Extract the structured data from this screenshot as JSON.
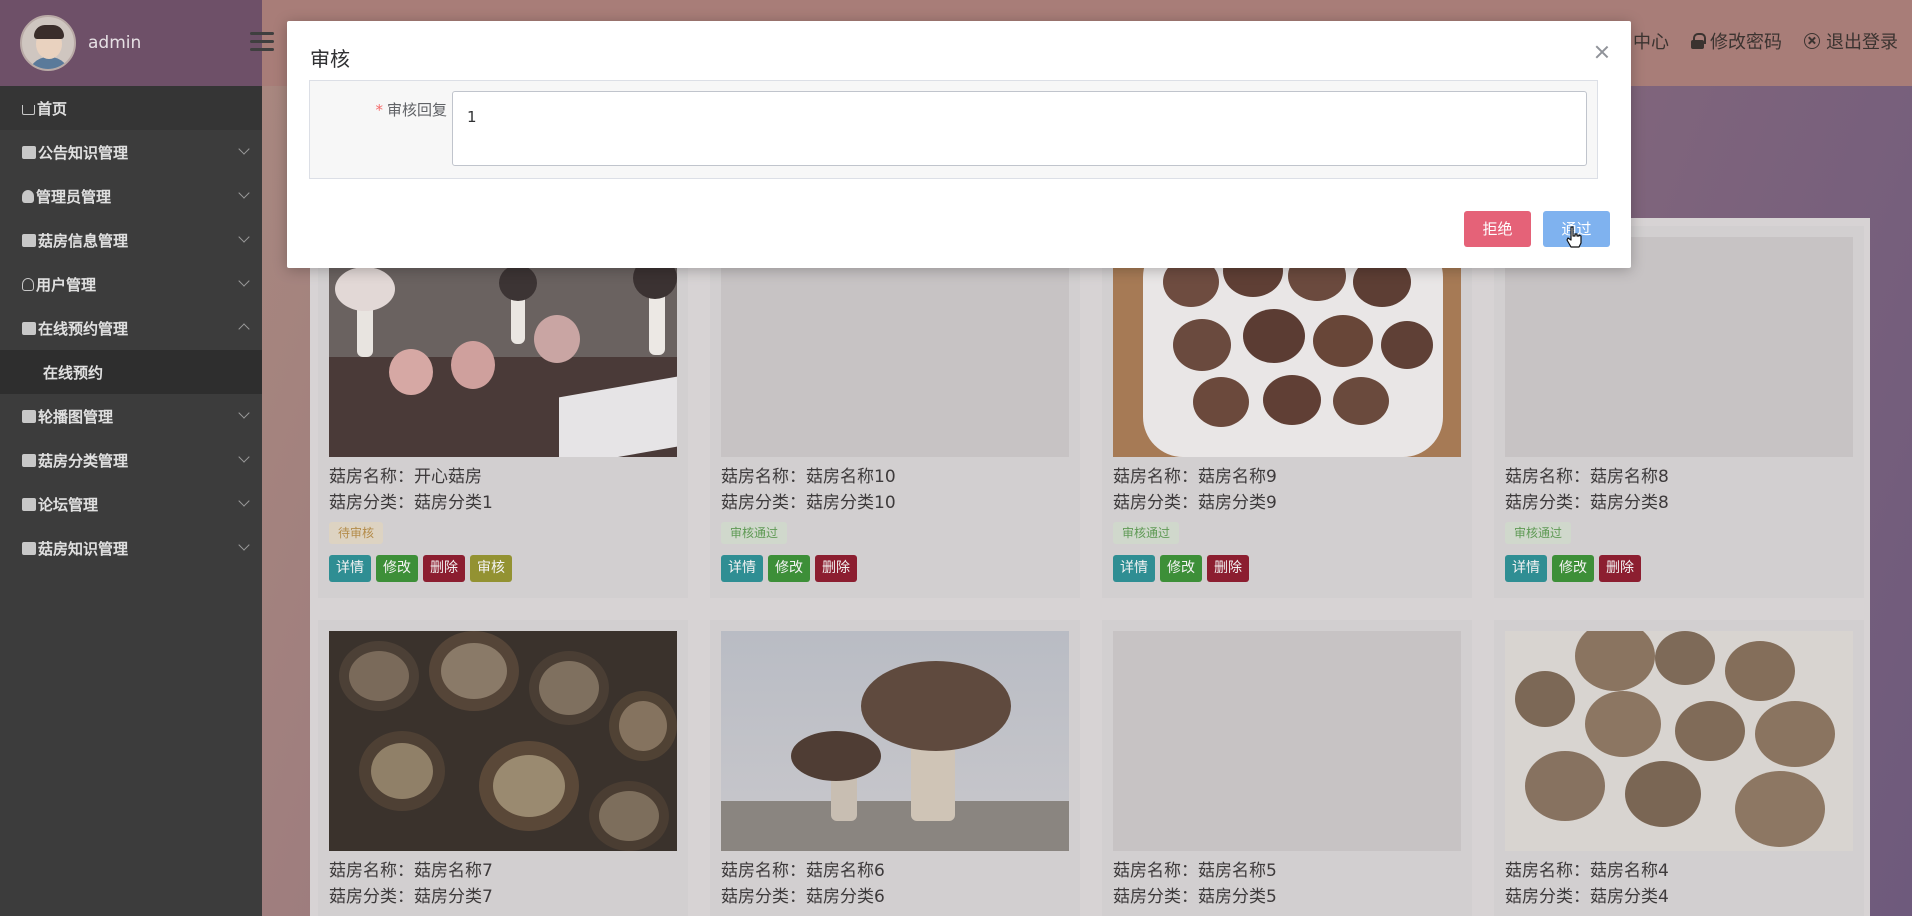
{
  "sidebar": {
    "username": "admin",
    "items": [
      {
        "label": "首页",
        "icon": "home-icon"
      },
      {
        "label": "公告知识管理",
        "icon": "briefcase-icon"
      },
      {
        "label": "管理员管理",
        "icon": "user-icon"
      },
      {
        "label": "菇房信息管理",
        "icon": "printer-icon"
      },
      {
        "label": "用户管理",
        "icon": "user-outline-icon"
      },
      {
        "label": "在线预约管理",
        "icon": "folder-icon",
        "expanded": true,
        "children": [
          "在线预约"
        ]
      },
      {
        "label": "轮播图管理",
        "icon": "list-icon"
      },
      {
        "label": "菇房分类管理",
        "icon": "list-icon"
      },
      {
        "label": "论坛管理",
        "icon": "bank-icon"
      },
      {
        "label": "菇房知识管理",
        "icon": "book-icon"
      }
    ]
  },
  "topbar": {
    "center_partial": "中心",
    "change_password": "修改密码",
    "logout": "退出登录"
  },
  "cards": [
    {
      "name": "菇房名称：开心菇房",
      "category": "菇房分类：菇房分类1",
      "status": "待审核",
      "has_image": true,
      "buttons": [
        "详情",
        "修改",
        "删除",
        "审核"
      ]
    },
    {
      "name": "菇房名称：菇房名称10",
      "category": "菇房分类：菇房分类10",
      "status": "审核通过",
      "has_image": false,
      "buttons": [
        "详情",
        "修改",
        "删除"
      ]
    },
    {
      "name": "菇房名称：菇房名称9",
      "category": "菇房分类：菇房分类9",
      "status": "审核通过",
      "has_image": true,
      "buttons": [
        "详情",
        "修改",
        "删除"
      ]
    },
    {
      "name": "菇房名称：菇房名称8",
      "category": "菇房分类：菇房分类8",
      "status": "审核通过",
      "has_image": false,
      "buttons": [
        "详情",
        "修改",
        "删除"
      ]
    },
    {
      "name": "菇房名称：菇房名称7",
      "category": "菇房分类：菇房分类7",
      "has_image": true
    },
    {
      "name": "菇房名称：菇房名称6",
      "category": "菇房分类：菇房分类6",
      "has_image": true
    },
    {
      "name": "菇房名称：菇房名称5",
      "category": "菇房分类：菇房分类5",
      "has_image": false
    },
    {
      "name": "菇房名称：菇房名称4",
      "category": "菇房分类：菇房分类4",
      "has_image": true
    }
  ],
  "dialog": {
    "title": "审核",
    "field_label": "审核回复",
    "required_mark": "*",
    "reply_value": "1",
    "reject_label": "拒绝",
    "pass_label": "通过"
  },
  "colors": {
    "sidebar_bg": "#3c3c3c",
    "reject": "#e56278",
    "pass": "#7fb2ef",
    "detail": "#2f8e93",
    "edit": "#3d8f38",
    "delete": "#8c1e30",
    "audit": "#939232"
  }
}
